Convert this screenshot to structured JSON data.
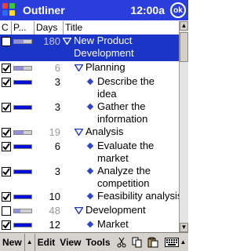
{
  "titlebar": {
    "app_title": "Outliner",
    "time": "12:00a",
    "ok_label": "ok"
  },
  "columns": {
    "check": "C",
    "progress": "P...",
    "days": "Days",
    "title": "Title"
  },
  "rows": [
    {
      "checked": false,
      "progress": 0.55,
      "days": "180",
      "days_grey": true,
      "twisty": "open",
      "title1": "New Product",
      "title2": "Development",
      "selected": true
    },
    {
      "checked": true,
      "progress": 0.55,
      "days": "6",
      "days_grey": true,
      "twisty": "open",
      "title1": "Planning"
    },
    {
      "checked": true,
      "progress": 1.0,
      "days": "3",
      "days_grey": false,
      "twisty": "leaf",
      "title1": "Describe the",
      "title2": "idea"
    },
    {
      "checked": true,
      "progress": 1.0,
      "days": "3",
      "days_grey": false,
      "twisty": "leaf",
      "title1": "Gather the",
      "title2": "information"
    },
    {
      "checked": true,
      "progress": 0.55,
      "days": "19",
      "days_grey": true,
      "twisty": "open",
      "title1": "Analysis"
    },
    {
      "checked": true,
      "progress": 1.0,
      "days": "6",
      "days_grey": false,
      "twisty": "leaf",
      "title1": "Evaluate the",
      "title2": "market"
    },
    {
      "checked": true,
      "progress": 1.0,
      "days": "3",
      "days_grey": false,
      "twisty": "leaf",
      "title1": "Analyze the",
      "title2": "competition"
    },
    {
      "checked": true,
      "progress": 1.0,
      "days": "10",
      "days_grey": false,
      "twisty": "leaf",
      "title1": "Feasibility analysis"
    },
    {
      "checked": false,
      "progress": 0.35,
      "days": "48",
      "days_grey": true,
      "twisty": "open",
      "title1": "Development"
    },
    {
      "checked": true,
      "progress": 1.0,
      "days": "12",
      "days_grey": false,
      "twisty": "leaf",
      "title1": "Market"
    }
  ],
  "menubar": {
    "new": "New",
    "edit": "Edit",
    "view": "View",
    "tools": "Tools",
    "icons": [
      "scissors-icon",
      "copy-icon",
      "paste-icon",
      "keyboard-icon"
    ]
  }
}
